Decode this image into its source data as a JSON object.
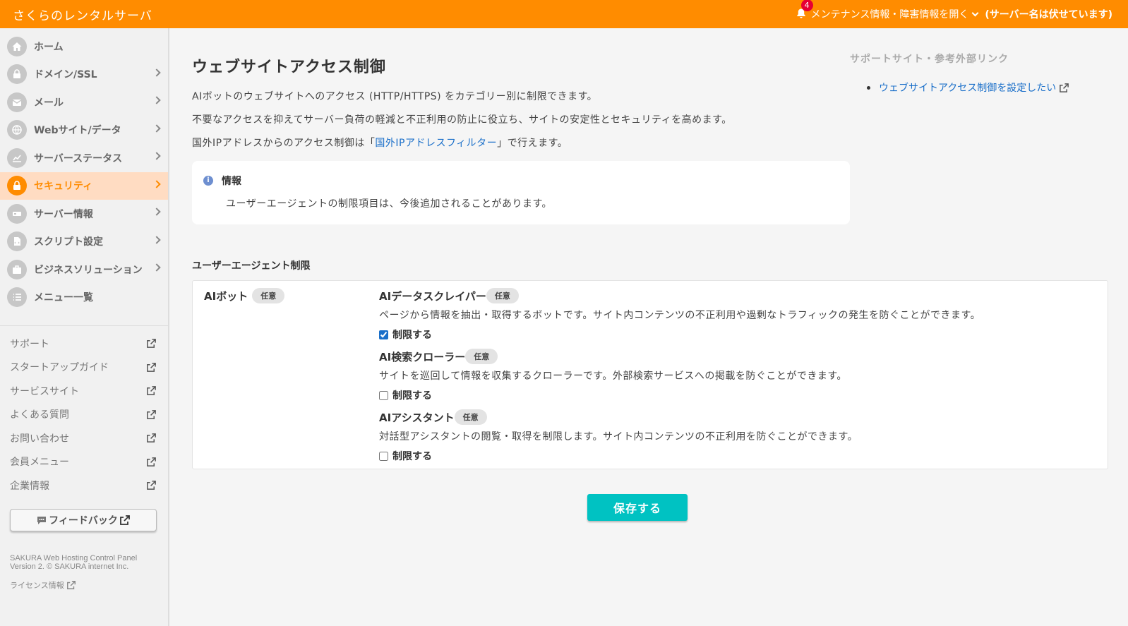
{
  "header": {
    "brand": "さくらのレンタルサーバ",
    "notification_count": "4",
    "maintenance_link": "メンテナンス情報・障害情報を開く",
    "server_name": "(サーバー名は伏せています)"
  },
  "sidebar": {
    "items": [
      {
        "label": "ホーム",
        "icon": "home-icon"
      },
      {
        "label": "ドメイン/SSL",
        "icon": "ssl-icon"
      },
      {
        "label": "メール",
        "icon": "mail-icon"
      },
      {
        "label": "Webサイト/データ",
        "icon": "globe-icon"
      },
      {
        "label": "サーバーステータス",
        "icon": "chart-icon"
      },
      {
        "label": "セキュリティ",
        "icon": "lock-icon"
      },
      {
        "label": "サーバー情報",
        "icon": "server-icon"
      },
      {
        "label": "スクリプト設定",
        "icon": "script-icon"
      },
      {
        "label": "ビジネスソリューション",
        "icon": "briefcase-icon"
      },
      {
        "label": "メニュー一覧",
        "icon": "list-icon"
      }
    ],
    "external_links": [
      "サポート",
      "スタートアップガイド",
      "サービスサイト",
      "よくある質問",
      "お問い合わせ",
      "会員メニュー",
      "企業情報"
    ],
    "feedback": "フィードバック",
    "copyright_line1": "SAKURA Web Hosting Control Panel",
    "copyright_line2": "Version 2. © SAKURA internet Inc.",
    "license": "ライセンス情報"
  },
  "main": {
    "title": "ウェブサイトアクセス制御",
    "desc1": "AIボットのウェブサイトへのアクセス (HTTP/HTTPS) をカテゴリー別に制限できます。",
    "desc2": "不要なアクセスを抑えてサーバー負荷の軽減と不正利用の防止に役立ち、サイトの安定性とセキュリティを高めます。",
    "desc3_pre": "国外IPアドレスからのアクセス制御は「",
    "desc3_link": "国外IPアドレスフィルター",
    "desc3_post": "」で行えます。",
    "info_title": "情報",
    "info_body": "ユーザーエージェントの制限項目は、今後追加されることがあります。",
    "side_links_title": "サポートサイト・参考外部リンク",
    "side_link": "ウェブサイトアクセス制御を設定したい",
    "section_title": "ユーザーエージェント制限",
    "row_label": "AIボット",
    "optional_badge": "任意",
    "options": [
      {
        "title": "AIデータスクレイパー",
        "desc": "ページから情報を抽出・取得するボットです。サイト内コンテンツの不正利用や過剰なトラフィックの発生を防ぐことができます。",
        "check_label": "制限する",
        "checked": true
      },
      {
        "title": "AI検索クローラー",
        "desc": "サイトを巡回して情報を収集するクローラーです。外部検索サービスへの掲載を防ぐことができます。",
        "check_label": "制限する",
        "checked": false
      },
      {
        "title": "AIアシスタント",
        "desc": "対話型アシスタントの閲覧・取得を制限します。サイト内コンテンツの不正利用を防ぐことができます。",
        "check_label": "制限する",
        "checked": false
      }
    ],
    "save_button": "保存する"
  },
  "colors": {
    "brand_orange": "#ff8c00",
    "active_bg": "#ffdcc2",
    "save_teal": "#00c2c2",
    "link_blue": "#1a6fc9"
  }
}
